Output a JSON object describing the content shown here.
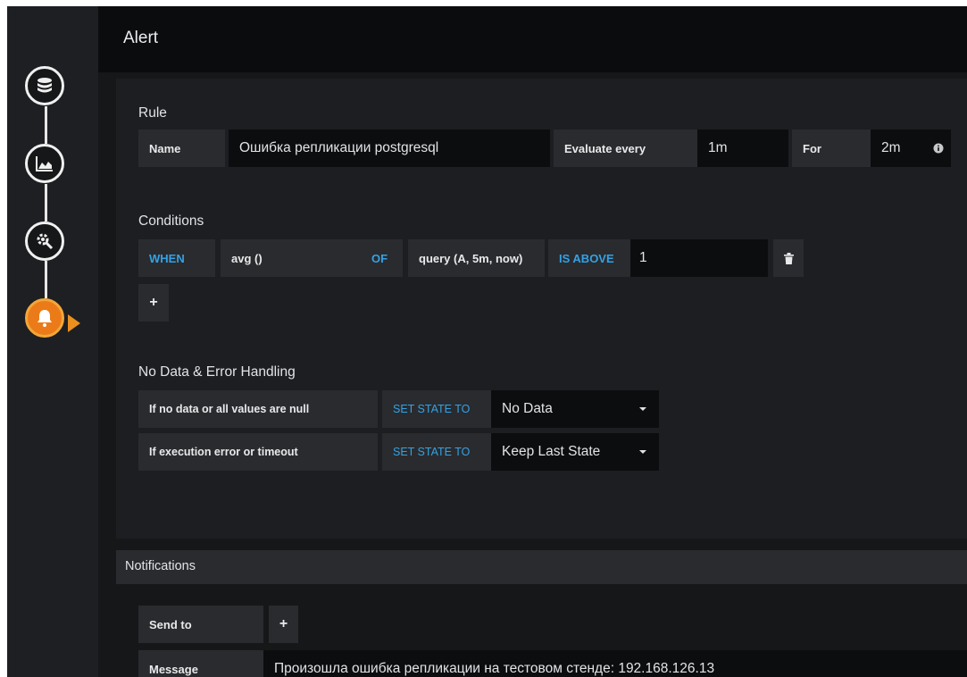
{
  "header": {
    "title": "Alert"
  },
  "sidebar": {
    "steps": [
      {
        "icon": "database-icon"
      },
      {
        "icon": "chart-icon"
      },
      {
        "icon": "settings-icon"
      },
      {
        "icon": "bell-icon",
        "active": true
      }
    ]
  },
  "rule": {
    "section_title": "Rule",
    "name_label": "Name",
    "name_value": "Ошибка репликации postgresql",
    "evaluate_label": "Evaluate every",
    "evaluate_value": "1m",
    "for_label": "For",
    "for_value": "2m"
  },
  "conditions": {
    "section_title": "Conditions",
    "when": "WHEN",
    "reducer": "avg ()",
    "of": "OF",
    "query": "query (A, 5m, now)",
    "evaluator": "IS ABOVE",
    "threshold": "1",
    "add_label": "+"
  },
  "no_data": {
    "section_title": "No Data & Error Handling",
    "rows": [
      {
        "label": "If no data or all values are null",
        "set_state": "SET STATE TO",
        "value": "No Data"
      },
      {
        "label": "If execution error or timeout",
        "set_state": "SET STATE TO",
        "value": "Keep Last State"
      }
    ]
  },
  "notifications": {
    "title": "Notifications",
    "send_to_label": "Send to",
    "add_label": "+",
    "message_label": "Message",
    "message_value": "Произошла ошибка репликации на тестовом стенде: 192.168.126.13"
  },
  "colors": {
    "accent": "#33a2e5",
    "active_step": "#eb7b18"
  }
}
